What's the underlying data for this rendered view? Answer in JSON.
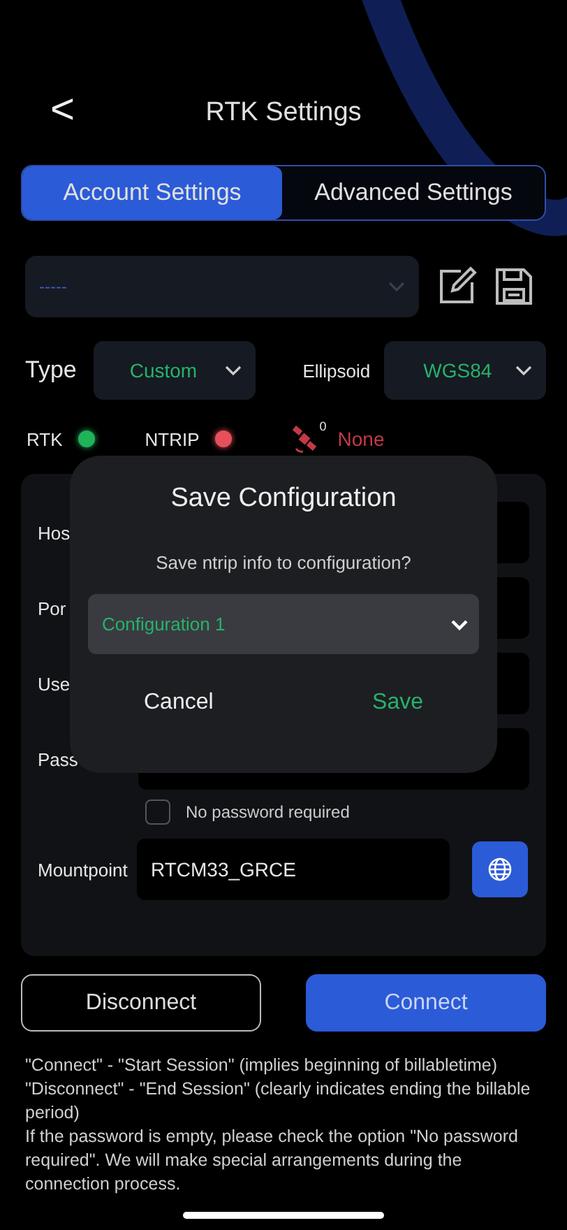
{
  "header": {
    "back": "<",
    "title": "RTK Settings"
  },
  "tabs": [
    {
      "label": "Account  Settings",
      "selected": true
    },
    {
      "label": "Advanced Settings",
      "selected": false
    }
  ],
  "config_select": {
    "value": "-----"
  },
  "type": {
    "label": "Type",
    "value": "Custom"
  },
  "ellipsoid": {
    "label": "Ellipsoid",
    "value": "WGS84"
  },
  "status": [
    {
      "label": "RTK",
      "color": "#1fb35a"
    },
    {
      "label": "NTRIP",
      "color": "#e5505c"
    }
  ],
  "satellites": {
    "count": "0",
    "text": "None"
  },
  "form": {
    "fields": [
      {
        "label": "Hos"
      },
      {
        "label": "Por"
      },
      {
        "label": "Use"
      },
      {
        "label": "Pass"
      }
    ],
    "no_password": {
      "label": "No password required",
      "checked": false
    },
    "mountpoint": {
      "label": "Mountpoint",
      "value": "RTCM33_GRCE"
    }
  },
  "buttons": [
    {
      "label": "Disconnect",
      "kind": "outline"
    },
    {
      "label": "Connect",
      "kind": "primary"
    }
  ],
  "notes": [
    "\"Connect\" - \"Start Session\" (implies beginning of billabletime)",
    "\"Disconnect\" - \"End Session\" (clearly indicates ending the billable period)",
    "If the password is empty, please check the option \"No password required\". We will make special arrangements during the connection process."
  ],
  "dialog": {
    "title": "Save Configuration",
    "message": "Save ntrip info to configuration?",
    "select": "Configuration 1",
    "cancel": "Cancel",
    "confirm": "Save"
  }
}
